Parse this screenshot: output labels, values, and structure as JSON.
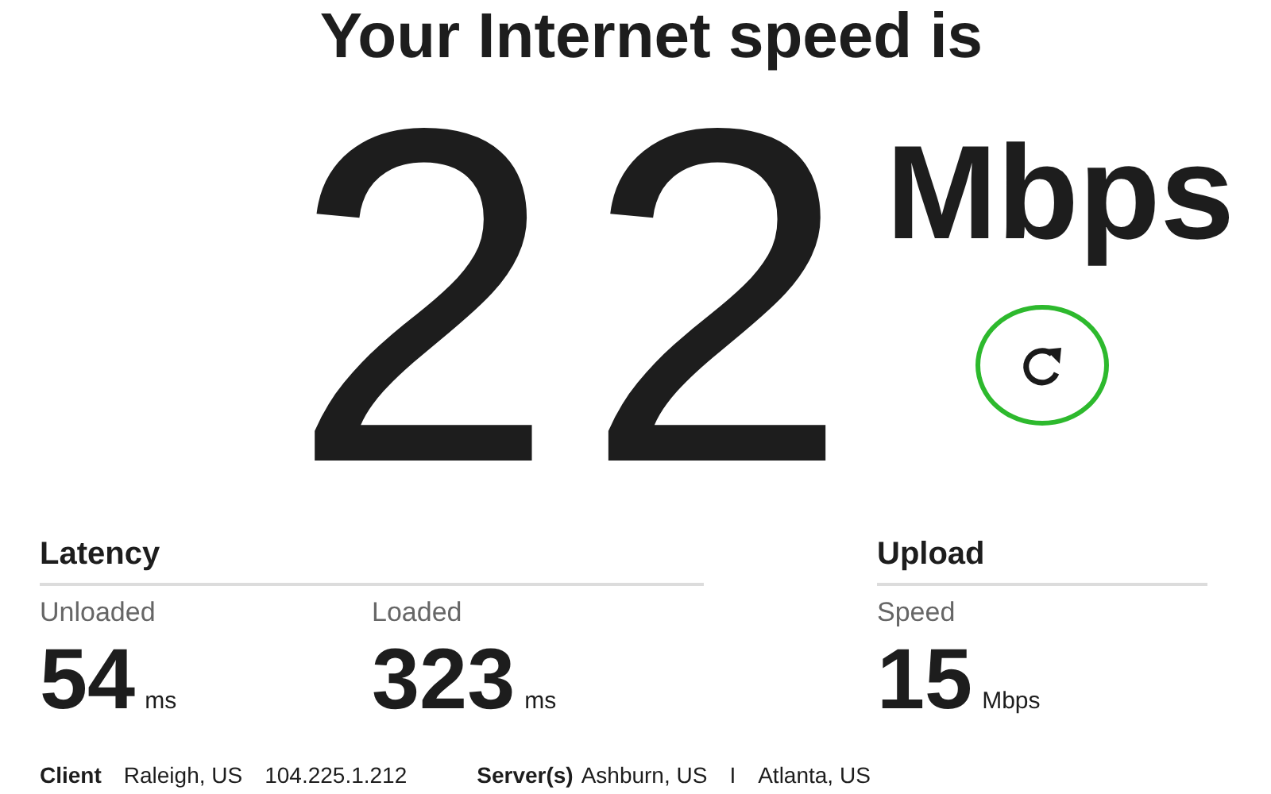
{
  "title": "Your Internet speed is",
  "download": {
    "value": "22",
    "unit": "Mbps"
  },
  "sections": [
    {
      "heading": "Latency",
      "metrics": [
        {
          "label": "Unloaded",
          "value": "54",
          "unit": "ms"
        },
        {
          "label": "Loaded",
          "value": "323",
          "unit": "ms"
        }
      ]
    },
    {
      "heading": "Upload",
      "metrics": [
        {
          "label": "Speed",
          "value": "15",
          "unit": "Mbps"
        }
      ]
    }
  ],
  "footer": {
    "client_label": "Client",
    "client_location": "Raleigh, US",
    "client_ip": "104.225.1.212",
    "server_label": "Server(s)",
    "servers": [
      "Ashburn, US",
      "Atlanta, US"
    ],
    "separator": "I"
  }
}
